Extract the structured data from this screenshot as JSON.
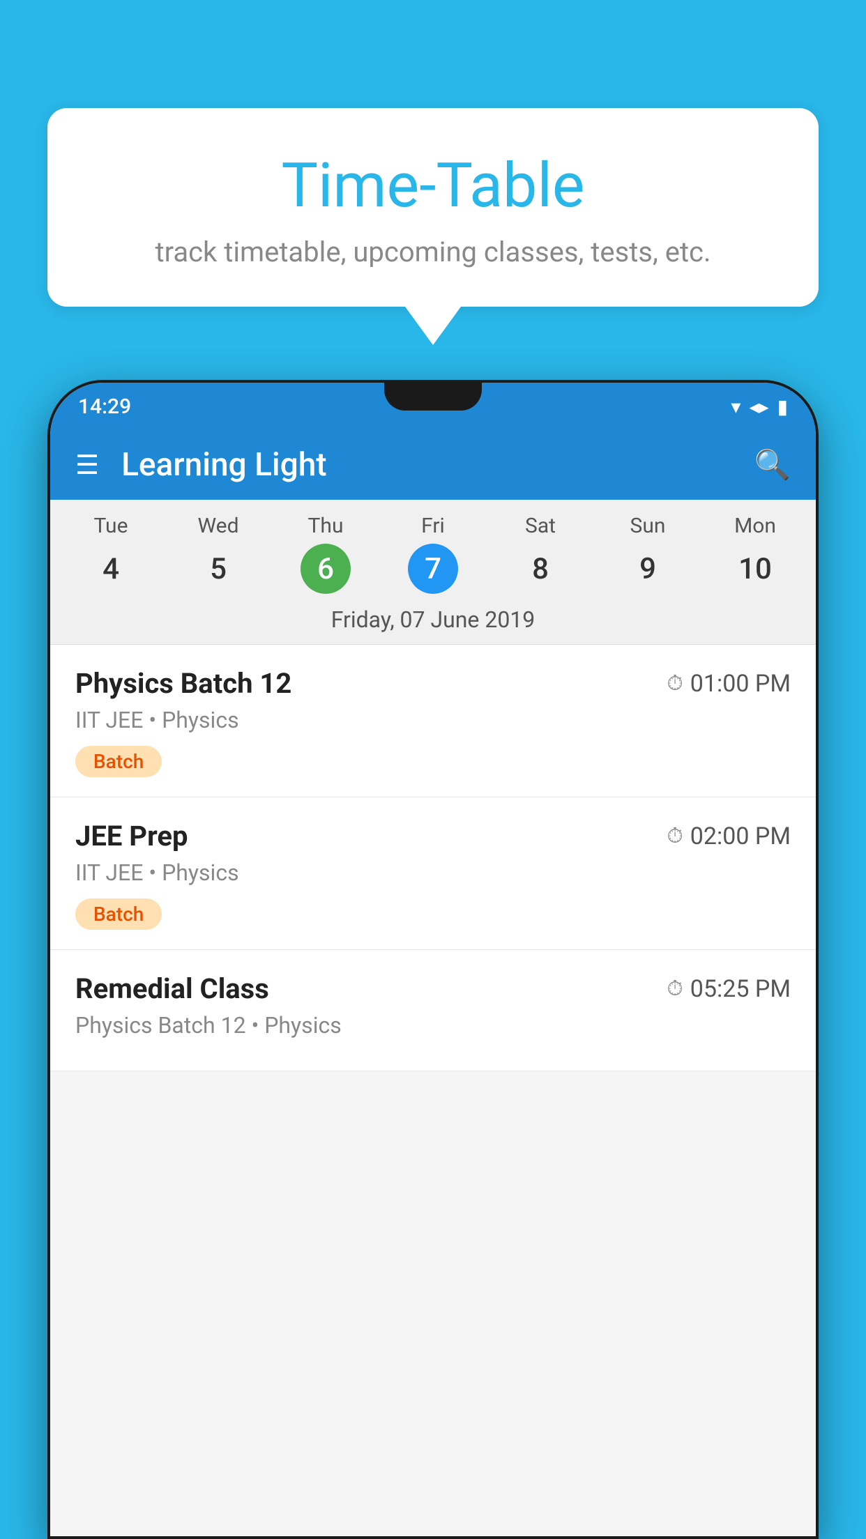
{
  "background_color": "#29b6e8",
  "bubble": {
    "title": "Time-Table",
    "subtitle": "track timetable, upcoming classes, tests, etc."
  },
  "phone": {
    "status_bar": {
      "time": "14:29",
      "icons": [
        "wifi",
        "signal",
        "battery"
      ]
    },
    "app_bar": {
      "title": "Learning Light",
      "hamburger_label": "≡",
      "search_label": "🔍"
    },
    "calendar": {
      "days": [
        {
          "name": "Tue",
          "num": "4",
          "state": "normal"
        },
        {
          "name": "Wed",
          "num": "5",
          "state": "normal"
        },
        {
          "name": "Thu",
          "num": "6",
          "state": "today"
        },
        {
          "name": "Fri",
          "num": "7",
          "state": "selected"
        },
        {
          "name": "Sat",
          "num": "8",
          "state": "normal"
        },
        {
          "name": "Sun",
          "num": "9",
          "state": "normal"
        },
        {
          "name": "Mon",
          "num": "10",
          "state": "normal"
        }
      ],
      "selected_date_label": "Friday, 07 June 2019"
    },
    "classes": [
      {
        "name": "Physics Batch 12",
        "time": "01:00 PM",
        "meta": "IIT JEE • Physics",
        "badge": "Batch"
      },
      {
        "name": "JEE Prep",
        "time": "02:00 PM",
        "meta": "IIT JEE • Physics",
        "badge": "Batch"
      },
      {
        "name": "Remedial Class",
        "time": "05:25 PM",
        "meta": "Physics Batch 12 • Physics",
        "badge": null
      }
    ]
  }
}
